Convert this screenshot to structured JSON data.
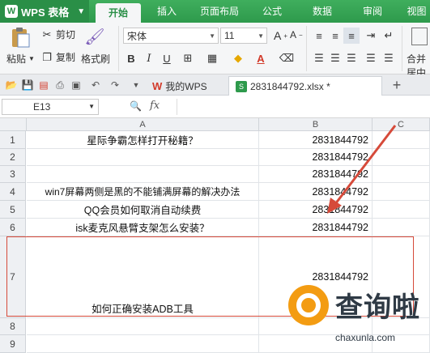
{
  "app": {
    "name": "WPS 表格",
    "tabs": [
      "开始",
      "插入",
      "页面布局",
      "公式",
      "数据",
      "审阅",
      "视图"
    ]
  },
  "ribbon": {
    "paste": "粘贴",
    "cut": "剪切",
    "copy": "复制",
    "format_painter": "格式刷",
    "font_name": "宋体",
    "font_size": "11",
    "merge_center": "合并居中",
    "font_increase": "A",
    "font_decrease": "A",
    "bold": "B",
    "italic": "I",
    "underline": "U",
    "font_color": "A"
  },
  "doc_tabs": {
    "home": "我的WPS",
    "file": "2831844792.xlsx *"
  },
  "formula_bar": {
    "cell_ref": "E13",
    "fx_label": "fx",
    "value": ""
  },
  "sheet": {
    "columns": [
      "A",
      "B",
      "C"
    ],
    "rows": [
      {
        "num": "1",
        "a": "星际争霸怎样打开秘籍？",
        "b": "2831844792"
      },
      {
        "num": "2",
        "a": "",
        "b": "2831844792"
      },
      {
        "num": "3",
        "a": "",
        "b": "2831844792"
      },
      {
        "num": "4",
        "a": "win7屏幕两侧是黑的不能铺满屏幕的解决办法",
        "b": "2831844792"
      },
      {
        "num": "5",
        "a": "QQ会员如何取消自动续费",
        "b": "2831844792"
      },
      {
        "num": "6",
        "a": "isk麦克风悬臂支架怎么安装？",
        "b": "2831844792"
      },
      {
        "num": "7",
        "a": "如何正确安装ADB工具",
        "b": "2831844792"
      },
      {
        "num": "8",
        "a": "",
        "b": ""
      },
      {
        "num": "9",
        "a": "",
        "b": ""
      }
    ]
  },
  "watermark": {
    "title": "查询啦",
    "url": "chaxunla.com"
  },
  "colors": {
    "brand_green": "#2e9a4c",
    "annotation_red": "#d64a3a",
    "watermark_orange": "#f39c12"
  }
}
